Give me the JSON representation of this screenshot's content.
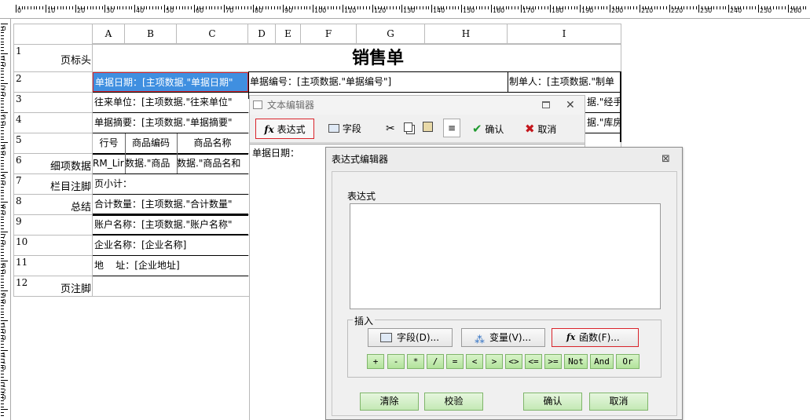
{
  "ruler": {
    "top_labels": [
      "0",
      "10",
      "20",
      "30",
      "40",
      "50",
      "60",
      "70",
      "80",
      "90",
      "100",
      "110",
      "120",
      "130",
      "140",
      "150",
      "160",
      "170",
      "180",
      "190",
      "200",
      "210",
      "220",
      "230",
      "240",
      "250",
      "260"
    ],
    "side_labels": [
      "0",
      "10",
      "20",
      "30",
      "40",
      "50",
      "60",
      "70",
      "80",
      "90",
      "100",
      "110",
      "120",
      "130"
    ]
  },
  "sheet": {
    "columns": [
      "A",
      "B",
      "C",
      "D",
      "E",
      "F",
      "G",
      "H",
      "I"
    ],
    "rows": [
      "1",
      "2",
      "3",
      "4",
      "5",
      "6",
      "7",
      "8",
      "9",
      "10",
      "11",
      "12"
    ],
    "bands": {
      "page_header": "页标头",
      "detail": "细项数据",
      "column_footer": "栏目注脚",
      "summary": "总结",
      "page_footer": "页注脚"
    },
    "title": "销售单",
    "cells": {
      "r2_date": "单据日期：[主项数据.\"单据日期\"",
      "r2_number": "单据编号：[主项数据.\"单据编号\"]",
      "r2_maker": "制单人：[主项数据.\"制单",
      "r3_unit": "往来单位：[主项数据.\"往来单位\"",
      "r3_right": "据.\"经手",
      "r4_summary": "单据摘要：[主项数据.\"单据摘要\"",
      "r4_right": "据.\"库房",
      "r5_h1": "行号",
      "r5_h2": "商品编码",
      "r5_h3": "商品名称",
      "r6_c1": "RM_Lir",
      "r6_c2": "数据.\"商品",
      "r6_c3": "数据.\"商品名和",
      "r7_subtotal": "页小计：",
      "r8_qty": "合计数量：[主项数据.\"合计数量\"",
      "r9_account": "账户名称：[主项数据.\"账户名称\"",
      "r10_company": "企业名称：[企业名称]",
      "r11_address": "地    址：[企业地址]"
    }
  },
  "text_editor": {
    "title": "文本编辑器",
    "toolbar": {
      "expression": "表达式",
      "field": "字段",
      "ok": "确认",
      "cancel": "取消"
    },
    "content": "单据日期："
  },
  "expression_editor": {
    "title": "表达式编辑器",
    "expression_label": "表达式",
    "expression_value": "",
    "insert_label": "插入",
    "insert_field": "字段(D)...",
    "insert_variable": "变量(V)...",
    "insert_function": "函数(F)...",
    "operators": [
      "+",
      "-",
      "*",
      "/",
      "=",
      "<",
      ">",
      "<>",
      "<=",
      ">=",
      "Not",
      "And",
      "Or"
    ],
    "buttons": {
      "clear": "清除",
      "verify": "校验",
      "ok": "确认",
      "cancel": "取消"
    }
  },
  "colors": {
    "selected_cell": "#3f8fe0",
    "highlight_border": "#d9232a",
    "green_button": "#c4e9b5"
  }
}
